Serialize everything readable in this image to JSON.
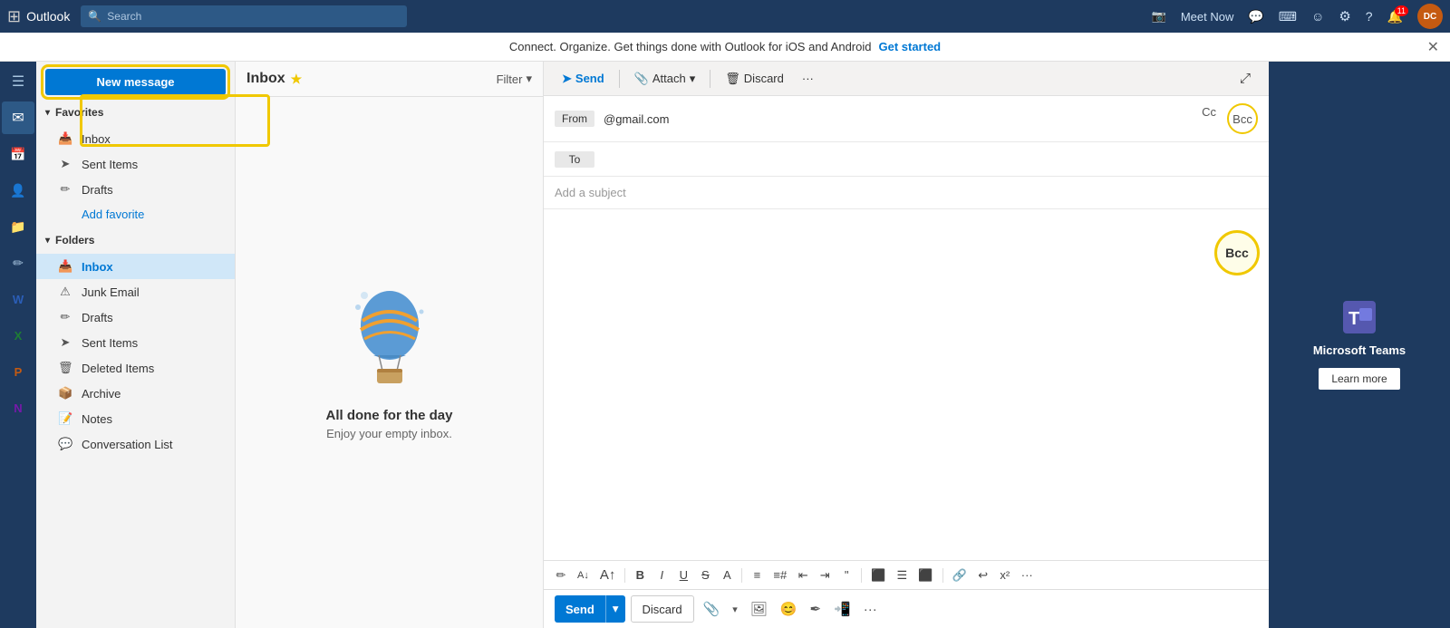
{
  "app": {
    "name": "Outlook",
    "search_placeholder": "Search"
  },
  "titlebar": {
    "grid_icon": "⊞",
    "meet_now": "Meet Now",
    "skype_icon": "S",
    "settings_icon": "⚙",
    "help_icon": "?",
    "notifications": "11",
    "avatar": "DC"
  },
  "banner": {
    "text": "Connect. Organize. Get things done with Outlook for iOS and Android",
    "cta": "Get started",
    "close": "✕"
  },
  "sidebar": {
    "new_message_label": "New message",
    "hamburger": "☰",
    "favorites_label": "Favorites",
    "folders_label": "Folders",
    "favorites_items": [
      {
        "icon": "📥",
        "label": "Inbox",
        "id": "fav-inbox"
      },
      {
        "icon": "📤",
        "label": "Sent Items",
        "id": "fav-sent"
      },
      {
        "icon": "✏️",
        "label": "Drafts",
        "id": "fav-drafts"
      }
    ],
    "add_favorite": "Add favorite",
    "folder_items": [
      {
        "icon": "📥",
        "label": "Inbox",
        "id": "folder-inbox",
        "active": true
      },
      {
        "icon": "🗑️",
        "label": "Junk Email",
        "id": "folder-junk"
      },
      {
        "icon": "✏️",
        "label": "Drafts",
        "id": "folder-drafts"
      },
      {
        "icon": "📤",
        "label": "Sent Items",
        "id": "folder-sent"
      },
      {
        "icon": "🗑️",
        "label": "Deleted Items",
        "id": "folder-deleted"
      },
      {
        "icon": "📦",
        "label": "Archive",
        "id": "folder-archive"
      },
      {
        "icon": "📝",
        "label": "Notes",
        "id": "folder-notes"
      },
      {
        "icon": "📋",
        "label": "Conversation List",
        "id": "folder-conv"
      }
    ]
  },
  "message_list": {
    "title": "Inbox",
    "star": "★",
    "filter": "Filter",
    "empty_title": "All done for the day",
    "empty_sub": "Enjoy your empty inbox."
  },
  "compose": {
    "toolbar": {
      "send": "Send",
      "attach": "Attach",
      "attach_chevron": "▾",
      "discard": "Discard",
      "more": "···"
    },
    "from_label": "From",
    "from_value": "@gmail.com",
    "to_label": "To",
    "cc": "Cc",
    "bcc": "Bcc",
    "subject_placeholder": "Add a subject",
    "expand_icon": "⤢"
  },
  "format_toolbar": {
    "buttons": [
      "✏",
      "A",
      "A",
      "B",
      "I",
      "U",
      "A̲",
      "A",
      "≡",
      "≡",
      "⇤",
      "⇥",
      "❝",
      "≡",
      "≡",
      "≡",
      "🔗",
      "↩",
      "x²",
      "···"
    ]
  },
  "send_toolbar": {
    "send": "Send",
    "chevron": "▾",
    "discard": "Discard",
    "more": "···"
  },
  "ad": {
    "logo": "🟦",
    "title": "Microsoft Teams",
    "learn_more": "Learn more"
  },
  "rail_icons": [
    "✉",
    "📅",
    "👥",
    "📁",
    "✏",
    "W",
    "X",
    "P",
    "N"
  ]
}
